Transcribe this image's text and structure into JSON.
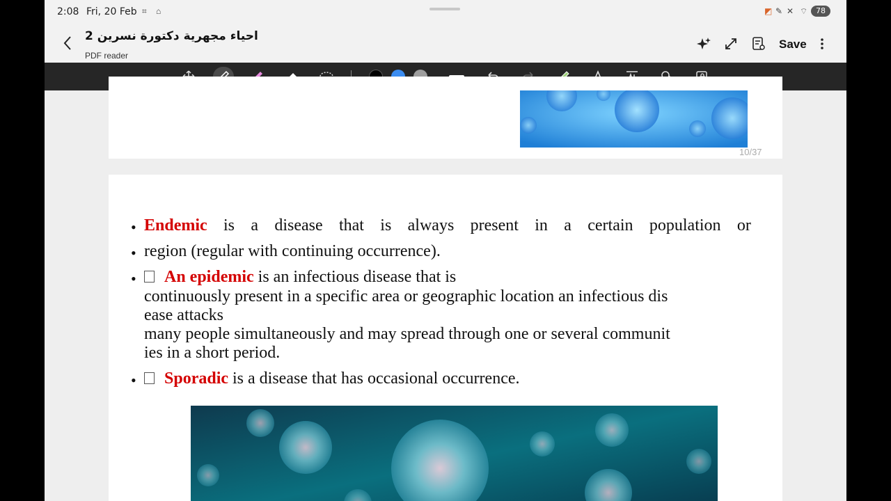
{
  "status": {
    "time": "2:08",
    "date": "Fri, 20 Feb",
    "battery": "78"
  },
  "app": {
    "title": "احياء مجهرية دكتورة نسرين 2",
    "subtitle": "PDF reader",
    "save_label": "Save"
  },
  "toolbar": {
    "tools": [
      "move-icon",
      "pen-icon",
      "highlighter-icon",
      "eraser-icon",
      "lasso-icon"
    ],
    "colors": [
      "#000000",
      "#3b8cf0",
      "#9e9e9e"
    ],
    "active_tool": "pen-icon"
  },
  "document": {
    "page_indicator": "10/37",
    "line1_words": [
      "is",
      "a",
      "disease",
      "that",
      "is",
      "always",
      "present",
      "in",
      "a",
      "certain",
      "population",
      "or"
    ],
    "line1_term": "Endemic",
    "line2": "region (regular with continuing occurrence).",
    "epidemic_term": "An epidemic",
    "epidemic_rest": " is an infectious disease that is",
    "epidemic_line2": "continuously present in a specific area or geographic location an infectious dis",
    "epidemic_line3": "ease attacks",
    "epidemic_line4": "many people simultaneously and may spread through one or several communit",
    "epidemic_line5": "ies in a short period.",
    "sporadic_term": "Sporadic",
    "sporadic_rest": " is a disease that has occasional occurrence."
  },
  "colors": {
    "accent_red": "#d40000",
    "toolbar_bg": "#262626"
  }
}
